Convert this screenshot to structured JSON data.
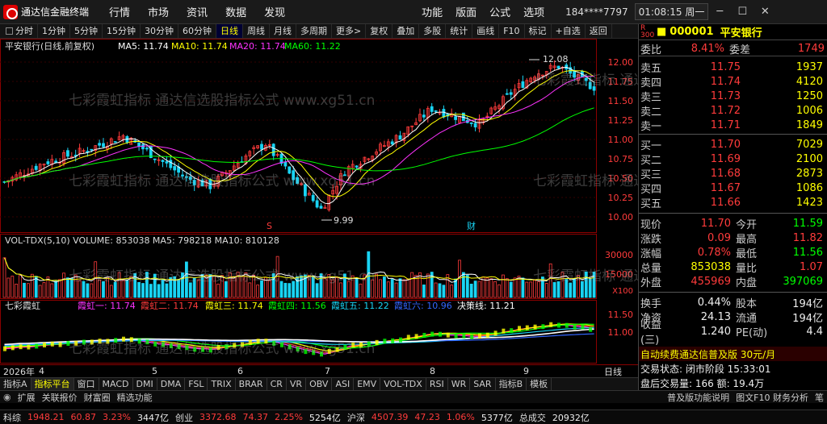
{
  "window": {
    "app_name": "通达信金融终端",
    "account": "184****7797",
    "time": "01:08:15 周一"
  },
  "menus": [
    "行情",
    "市场",
    "资讯",
    "数据",
    "发现"
  ],
  "menus_right": [
    "功能",
    "版面",
    "公式",
    "选项"
  ],
  "toolbar": {
    "periods": [
      "分时",
      "1分钟",
      "5分钟",
      "15分钟",
      "30分钟",
      "60分钟",
      "日线",
      "周线",
      "月线",
      "多周期",
      "更多>"
    ],
    "tools": [
      "复权",
      "叠加",
      "多股",
      "统计",
      "画线",
      "F10",
      "标记",
      "+自选",
      "返回"
    ]
  },
  "chart": {
    "main_title": "平安银行(日线,前复权)",
    "ma_labels": {
      "ma5": "MA5: 11.74",
      "ma10": "MA10: 11.74",
      "ma20": "MA20: 11.74",
      "ma60": "MA60: 11.22"
    },
    "high_mark": "12.08",
    "low_mark": "9.99",
    "markers": {
      "s": "S",
      "cai": "财"
    },
    "y_main": [
      "12.00",
      "11.75",
      "11.50",
      "11.25",
      "11.00",
      "10.75",
      "10.50",
      "10.25",
      "10.00"
    ],
    "vol_title": "VOL-TDX(5,10)  VOLUME: 853038  MA5: 798218  MA10: 810128",
    "y_vol": [
      "30000",
      "15000",
      "X100"
    ],
    "ind_title": "七彩霞虹",
    "ind_labels": [
      "霞虹一: 11.74",
      "霞虹二: 11.74",
      "霞虹三: 11.74",
      "霞虹四: 11.56",
      "霞虹五: 11.22",
      "霞虹六: 10.96",
      "决策线: 11.21"
    ],
    "y_ind": [
      "11.50",
      "11.00"
    ],
    "x_labels": [
      "2026年",
      "4",
      "5",
      "6",
      "7",
      "8",
      "9"
    ],
    "x_right": "日线",
    "watermark": "七彩霞虹指标 通达信选股指标公式 www.xg51.cn",
    "colors": {
      "up": "#ff3b3b",
      "down": "#19d4f4",
      "ma5": "#ffffff",
      "ma10": "#ffff00",
      "ma20": "#ff33ff",
      "ma60": "#00ff00"
    }
  },
  "quote": {
    "code": "000001",
    "name": "平安银行",
    "rz": "R",
    "num": "300",
    "weibi_label": "委比",
    "weibi": "8.41%",
    "weicha_label": "委差",
    "weicha": "1749",
    "asks": [
      {
        "label": "卖五",
        "price": "11.75",
        "vol": "1937"
      },
      {
        "label": "卖四",
        "price": "11.74",
        "vol": "4120"
      },
      {
        "label": "卖三",
        "price": "11.73",
        "vol": "1250"
      },
      {
        "label": "卖二",
        "price": "11.72",
        "vol": "1006"
      },
      {
        "label": "卖一",
        "price": "11.71",
        "vol": "1849"
      }
    ],
    "bids": [
      {
        "label": "买一",
        "price": "11.70",
        "vol": "7029"
      },
      {
        "label": "买二",
        "price": "11.69",
        "vol": "2100"
      },
      {
        "label": "买三",
        "price": "11.68",
        "vol": "2873"
      },
      {
        "label": "买四",
        "price": "11.67",
        "vol": "1086"
      },
      {
        "label": "买五",
        "price": "11.66",
        "vol": "1423"
      }
    ],
    "info": [
      {
        "l1": "现价",
        "v1": "11.70",
        "c1": "red",
        "l2": "今开",
        "v2": "11.59",
        "c2": "grn"
      },
      {
        "l1": "涨跌",
        "v1": "0.09",
        "c1": "red",
        "l2": "最高",
        "v2": "11.82",
        "c2": "red"
      },
      {
        "l1": "涨幅",
        "v1": "0.78%",
        "c1": "red",
        "l2": "最低",
        "v2": "11.56",
        "c2": "grn"
      },
      {
        "l1": "总量",
        "v1": "853038",
        "c1": "yel",
        "l2": "量比",
        "v2": "1.07",
        "c2": "red"
      },
      {
        "l1": "外盘",
        "v1": "455969",
        "c1": "red",
        "l2": "内盘",
        "v2": "397069",
        "c2": "grn"
      }
    ],
    "info2": [
      {
        "l1": "换手",
        "v1": "0.44%",
        "c1": "wht",
        "l2": "股本",
        "v2": "194亿",
        "c2": "wht"
      },
      {
        "l1": "净资",
        "v1": "24.13",
        "c1": "wht",
        "l2": "流通",
        "v2": "194亿",
        "c2": "wht"
      },
      {
        "l1": "收益(三)",
        "v1": "1.240",
        "c1": "wht",
        "l2": "PE(动)",
        "v2": "4.4",
        "c2": "wht"
      }
    ],
    "promo": "自动续费通达信普及版 30元/月",
    "trade_state": "交易状态: 闭市阶段  15:33:01",
    "after": "盘后交易量: 166  额: 19.4万"
  },
  "tabs": [
    "指标A",
    "指标平台",
    "窗口",
    "MACD",
    "DMI",
    "DMA",
    "FSL",
    "TRIX",
    "BRAR",
    "CR",
    "VR",
    "OBV",
    "ASI",
    "EMV",
    "VOL-TDX",
    "RSI",
    "WR",
    "SAR",
    "指标B",
    "模板"
  ],
  "bottom": {
    "items": [
      "扩展",
      "关联报价",
      "财富圈",
      "精选功能"
    ],
    "right": "普及版功能说明",
    "right2": "图文F10 财务分析",
    "right3": "笔"
  },
  "status": [
    {
      "name": "科综",
      "val": "1948.21",
      "chg": "60.87",
      "pct": "3.23%",
      "amt": "3447亿"
    },
    {
      "name": "创业",
      "val": "3372.68",
      "chg": "74.37",
      "pct": "2.25%",
      "amt": "5254亿"
    },
    {
      "name": "沪深",
      "val": "4507.39",
      "chg": "47.23",
      "pct": "1.06%",
      "amt": "5377亿"
    }
  ],
  "status_total": {
    "label": "总成交",
    "val": "20932亿"
  }
}
